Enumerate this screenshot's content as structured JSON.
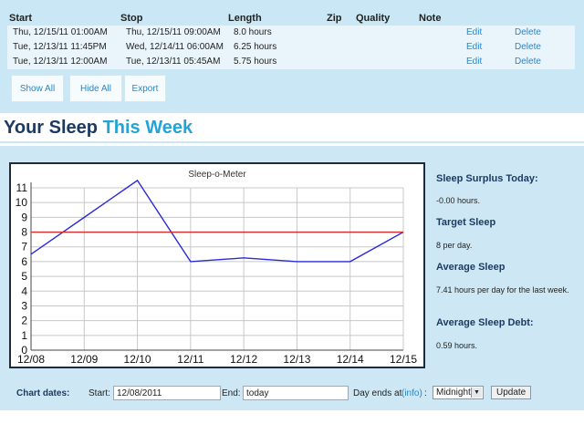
{
  "table": {
    "headers": [
      "Start",
      "Stop",
      "Length",
      "Zip",
      "Quality",
      "Note"
    ],
    "rows": [
      {
        "start": "Thu, 12/15/11 01:00AM",
        "stop": "Thu, 12/15/11 09:00AM",
        "length": "8.0 hours",
        "edit": "Edit",
        "delete": "Delete"
      },
      {
        "start": "Tue, 12/13/11 11:45PM",
        "stop": "Wed, 12/14/11 06:00AM",
        "length": "6.25 hours",
        "edit": "Edit",
        "delete": "Delete"
      },
      {
        "start": "Tue, 12/13/11 12:00AM",
        "stop": "Tue, 12/13/11 05:45AM",
        "length": "5.75 hours",
        "edit": "Edit",
        "delete": "Delete"
      }
    ],
    "buttons": {
      "show_all": "Show All",
      "hide_all": "Hide All",
      "export": "Export"
    }
  },
  "heading": {
    "part1": "Your Sleep",
    "part2": "This Week"
  },
  "chart_data": {
    "type": "line",
    "title": "Sleep-o-Meter",
    "categories": [
      "12/08",
      "12/09",
      "12/10",
      "12/11",
      "12/12",
      "12/13",
      "12/14",
      "12/15"
    ],
    "ylim": [
      0,
      11
    ],
    "yticks": [
      0,
      1,
      2,
      3,
      4,
      5,
      6,
      7,
      8,
      9,
      10,
      11
    ],
    "grid": true,
    "series": [
      {
        "values": [
          6.5,
          9,
          11.5,
          6,
          6.25,
          6,
          6,
          8
        ],
        "color": "#2b2bd6"
      },
      {
        "values": [
          8,
          8,
          8,
          8,
          8,
          8,
          8,
          8
        ],
        "color": "#d92b2b"
      }
    ]
  },
  "sidebar": {
    "surplus_label": "Sleep Surplus Today:",
    "surplus_value": "-0.00 hours.",
    "target_label": "Target Sleep",
    "target_value": "8 per day.",
    "average_label": "Average Sleep",
    "average_value": "7.41 hours per day for the last week.",
    "debt_label": "Average Sleep Debt:",
    "debt_value": "0.59 hours."
  },
  "chart_dates": {
    "label": "Chart dates:",
    "start_label": "Start:",
    "start_value": "12/08/2011",
    "end_label": "End:",
    "end_value": "today",
    "day_ends_label": "Day ends at",
    "info_link": "(info)",
    "colon": ":",
    "select_value": "Midnight",
    "update_label": "Update"
  }
}
